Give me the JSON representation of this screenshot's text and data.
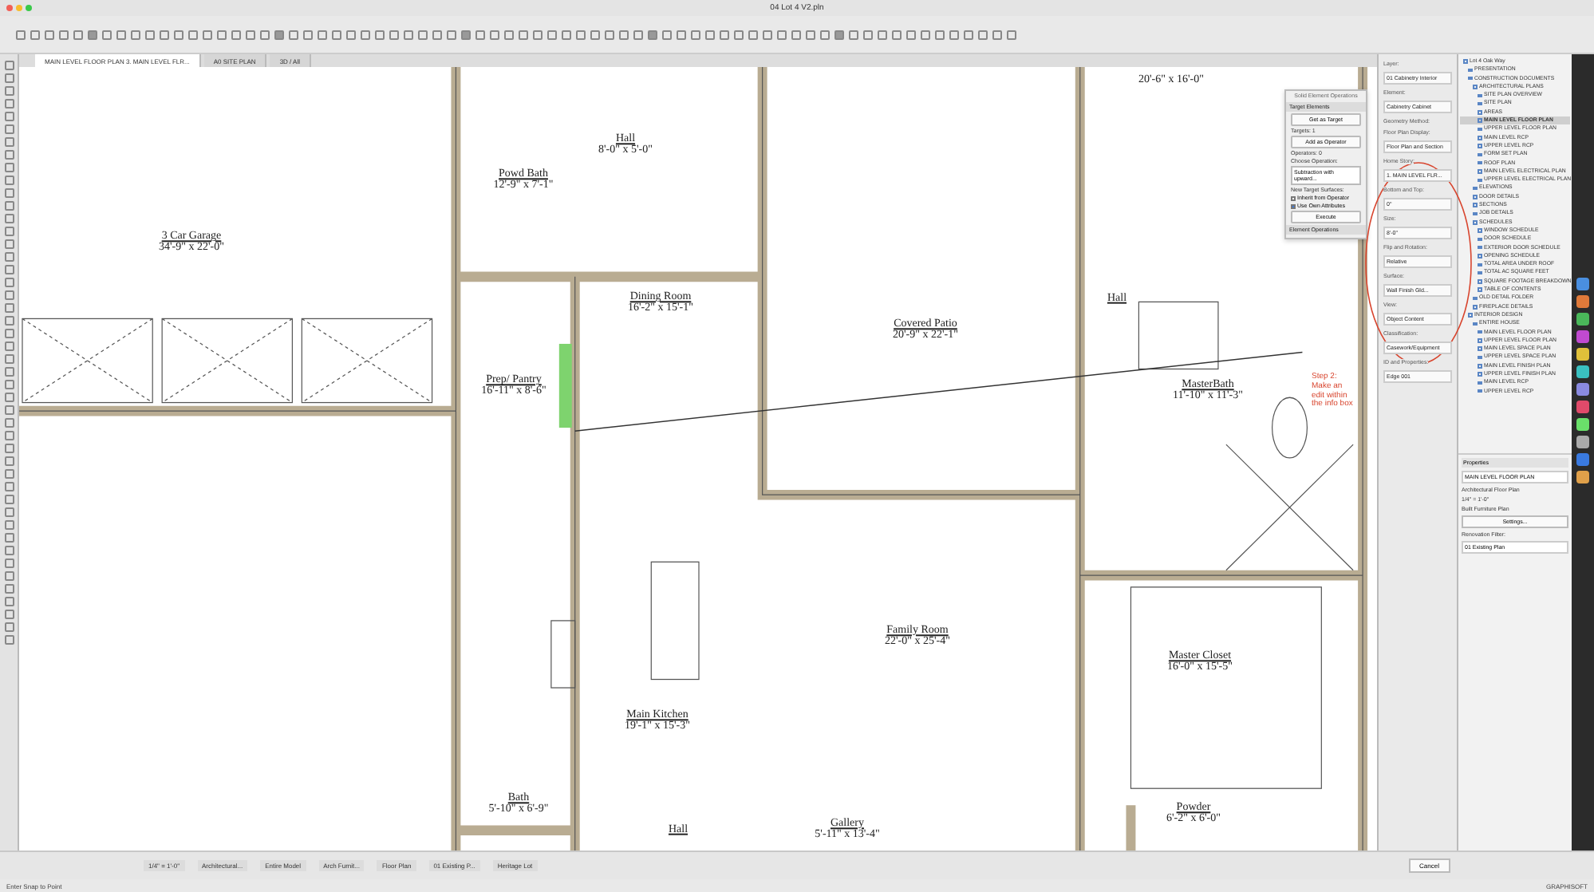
{
  "window": {
    "title": "04 Lot 4 V2.pln"
  },
  "view_tabs": [
    {
      "label": "MAIN LEVEL FLOOR PLAN 3. MAIN LEVEL FLR...",
      "selected": true
    },
    {
      "label": "A0 SITE PLAN",
      "selected": false
    },
    {
      "label": "3D / All",
      "selected": false
    }
  ],
  "rooms": [
    {
      "name": "3 Car Garage",
      "size": "34'-9\" x 22'-0\""
    },
    {
      "size": "20'-6\" x 16'-0\""
    },
    {
      "name": "Powd Bath",
      "size": "12'-9\" x 7'-1\""
    },
    {
      "name": "Hall",
      "size": "8'-0\" x 5'-0\""
    },
    {
      "name": "Dining Room",
      "size": "16'-2\" x 15'-1\""
    },
    {
      "name": "Covered Patio",
      "size": "20'-9\" x 22'-1\""
    },
    {
      "name": "Hall"
    },
    {
      "name": "Prep/ Pantry",
      "size": "16'-11\" x 8'-6\""
    },
    {
      "name": "MasterBath",
      "size": "11'-10\" x 11'-3\""
    },
    {
      "name": "Family Room",
      "size": "22'-0\" x 25'-4\""
    },
    {
      "name": "Master Closet",
      "size": "16'-0\" x 15'-5\""
    },
    {
      "name": "Main Kitchen",
      "size": "19'-1\" x 15'-3\""
    },
    {
      "name": "Bath",
      "size": "5'-10\" x 6'-9\""
    },
    {
      "name": "Hall"
    },
    {
      "name": "Gallery",
      "size": "5'-11\" x 13'-4\""
    },
    {
      "name": "Powder",
      "size": "6'-2\" x 6'-0\""
    }
  ],
  "annotation": {
    "text": "Step 2: Make an edit within the info box"
  },
  "operations_palette": {
    "title": "Solid Element Operations",
    "items": [
      {
        "kind": "section",
        "label": "Target Elements"
      },
      {
        "kind": "button",
        "label": "Get as Target"
      },
      {
        "kind": "text",
        "label": "Targets: 1"
      },
      {
        "kind": "button",
        "label": "Add as Operator"
      },
      {
        "kind": "text",
        "label": "Operators: 0"
      },
      {
        "kind": "text",
        "label": "Choose Operation:"
      },
      {
        "kind": "select",
        "label": "Subtraction with upward..."
      },
      {
        "kind": "text",
        "label": "New Target Surfaces:"
      },
      {
        "kind": "check",
        "label": "Inherit from Operator",
        "checked": false
      },
      {
        "kind": "check",
        "label": "Use Own Attributes",
        "checked": true
      },
      {
        "kind": "button",
        "label": "Execute"
      },
      {
        "kind": "section",
        "label": "Element Operations"
      }
    ]
  },
  "info_box": [
    {
      "label": "Layer:",
      "value": "01 Cabinetry Interior"
    },
    {
      "label": "Element:",
      "value": "Cabinetry Cabinet"
    },
    {
      "label": "Geometry Method:"
    },
    {
      "label": "Floor Plan Display:",
      "value": "Floor Plan and Section"
    },
    {
      "label": "Home Story:",
      "value": "1. MAIN LEVEL FLR..."
    },
    {
      "label": "Bottom and Top:",
      "value": "0\""
    },
    {
      "label": "Size:",
      "value": "8'-0\""
    },
    {
      "label": "Flip and Rotation:",
      "value": "Relative"
    },
    {
      "label": "Surface:",
      "value": "Wall Finish Gld..."
    },
    {
      "label": "View:",
      "value": "Object Content"
    },
    {
      "label": "Classification:",
      "value": "Casework/Equipment"
    },
    {
      "label": "ID and Properties:",
      "value": "Edge 001"
    }
  ],
  "navigator": [
    {
      "label": "Lot 4 Oak Way",
      "selected": false,
      "children": [
        {
          "label": "PRESENTATION",
          "selected": false
        },
        {
          "label": "CONSTRUCTION DOCUMENTS",
          "selected": false,
          "children": [
            {
              "label": "ARCHITECTURAL PLANS",
              "selected": false,
              "children": [
                {
                  "label": "SITE PLAN OVERVIEW",
                  "selected": false
                },
                {
                  "label": "SITE PLAN",
                  "selected": false
                },
                {
                  "label": "AREAS",
                  "selected": false
                },
                {
                  "label": "MAIN LEVEL FLOOR PLAN",
                  "selected": true
                },
                {
                  "label": "UPPER LEVEL FLOOR PLAN",
                  "selected": false
                },
                {
                  "label": "MAIN LEVEL RCP",
                  "selected": false
                },
                {
                  "label": "UPPER LEVEL RCP",
                  "selected": false
                },
                {
                  "label": "FORM SET PLAN",
                  "selected": false
                },
                {
                  "label": "ROOF PLAN",
                  "selected": false
                },
                {
                  "label": "MAIN LEVEL ELECTRICAL PLAN",
                  "selected": false
                },
                {
                  "label": "UPPER LEVEL ELECTRICAL PLAN",
                  "selected": false
                }
              ]
            },
            {
              "label": "ELEVATIONS",
              "selected": false
            },
            {
              "label": "DOOR DETAILS",
              "selected": false
            },
            {
              "label": "SECTIONS",
              "selected": false
            },
            {
              "label": "JOB DETAILS",
              "selected": false
            },
            {
              "label": "SCHEDULES",
              "selected": false,
              "children": [
                {
                  "label": "WINDOW SCHEDULE",
                  "selected": false
                },
                {
                  "label": "DOOR SCHEDULE",
                  "selected": false
                },
                {
                  "label": "EXTERIOR DOOR SCHEDULE",
                  "selected": false
                },
                {
                  "label": "OPENING SCHEDULE",
                  "selected": false
                },
                {
                  "label": "TOTAL AREA UNDER ROOF",
                  "selected": false
                },
                {
                  "label": "TOTAL AC SQUARE FEET",
                  "selected": false
                },
                {
                  "label": "SQUARE FOOTAGE BREAKDOWN",
                  "selected": false
                },
                {
                  "label": "TABLE OF CONTENTS",
                  "selected": false
                }
              ]
            },
            {
              "label": "OLD DETAIL FOLDER",
              "selected": false
            },
            {
              "label": "FIREPLACE DETAILS",
              "selected": false
            }
          ]
        },
        {
          "label": "INTERIOR DESIGN",
          "selected": false,
          "children": [
            {
              "label": "ENTIRE HOUSE",
              "selected": false,
              "children": [
                {
                  "label": "MAIN LEVEL FLOOR PLAN",
                  "selected": false
                },
                {
                  "label": "UPPER LEVEL FLOOR PLAN",
                  "selected": false
                },
                {
                  "label": "MAIN LEVEL SPACE PLAN",
                  "selected": false
                },
                {
                  "label": "UPPER LEVEL SPACE PLAN",
                  "selected": false
                },
                {
                  "label": "MAIN LEVEL FINISH PLAN",
                  "selected": false
                },
                {
                  "label": "UPPER LEVEL FINISH PLAN",
                  "selected": false
                },
                {
                  "label": "MAIN LEVEL RCP",
                  "selected": false
                },
                {
                  "label": "UPPER LEVEL RCP",
                  "selected": false
                }
              ]
            }
          ]
        }
      ]
    }
  ],
  "properties": {
    "title": "Properties",
    "view": "MAIN LEVEL FLOOR PLAN",
    "plan_type": "Architectural Floor Plan",
    "scale": "1/4\" = 1'-0\"",
    "layer_combo": "Built Furniture Plan",
    "settings": "Settings...",
    "filter_label": "Renovation Filter:",
    "filter": "01 Existing Plan"
  },
  "bottom_toolbar": [
    "1/4\" = 1'-0\"",
    "Architectural...",
    "Entire Model",
    "Arch Furnit...",
    "Floor Plan",
    "01 Existing P...",
    "Heritage Lot"
  ],
  "cancel_button": "Cancel",
  "status_bar": {
    "hint": "Enter Snap to Point",
    "brand": "GRAPHISOFT"
  }
}
